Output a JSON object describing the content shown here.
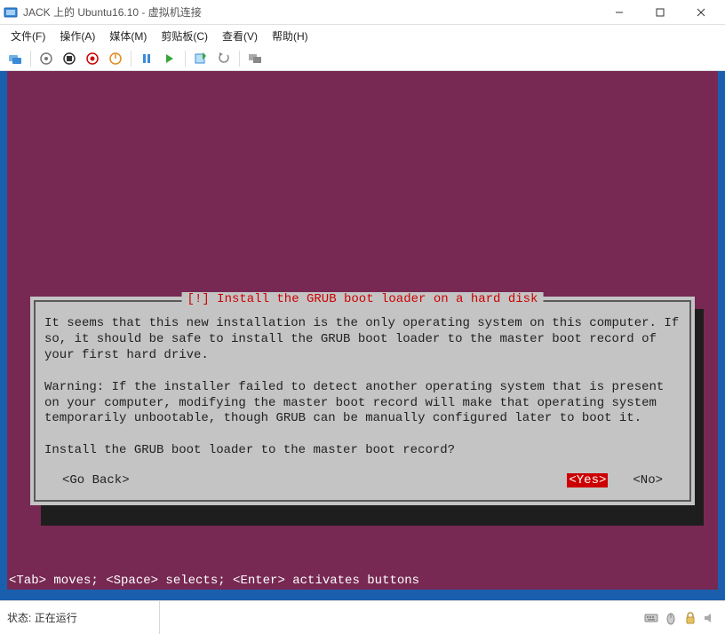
{
  "window": {
    "title": "JACK 上的 Ubuntu16.10 - 虚拟机连接"
  },
  "menu": {
    "file": "文件(F)",
    "action": "操作(A)",
    "media": "媒体(M)",
    "clipboard": "剪贴板(C)",
    "view": "查看(V)",
    "help": "帮助(H)"
  },
  "dialog": {
    "title_prefix": "[!]",
    "title": " Install the GRUB boot loader on a hard disk ",
    "body": "It seems that this new installation is the only operating system on this computer. If so, it should be safe to install the GRUB boot loader to the master boot record of your first hard drive.\n\nWarning: If the installer failed to detect another operating system that is present on your computer, modifying the master boot record will make that operating system temporarily unbootable, though GRUB can be manually configured later to boot it.\n\nInstall the GRUB boot loader to the master boot record?",
    "go_back": "<Go Back>",
    "yes": "<Yes>",
    "no": "<No>"
  },
  "helpbar": "<Tab> moves; <Space> selects; <Enter> activates buttons",
  "status": {
    "label": "状态:",
    "value": "正在运行"
  }
}
